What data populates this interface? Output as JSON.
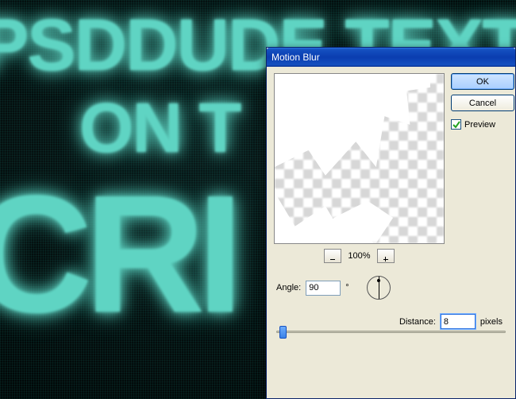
{
  "canvas": {
    "line1": "PSDDUDE TEXT",
    "line2": "ON T",
    "line3": "CRI"
  },
  "dialog": {
    "title": "Motion Blur",
    "buttons": {
      "ok": "OK",
      "cancel": "Cancel"
    },
    "preview_checkbox": {
      "label": "Preview",
      "checked": true
    },
    "zoom": {
      "percent": "100%"
    },
    "angle": {
      "label": "Angle:",
      "value": "90",
      "unit": "°"
    },
    "distance": {
      "label": "Distance:",
      "value": "8",
      "unit": "pixels"
    }
  }
}
